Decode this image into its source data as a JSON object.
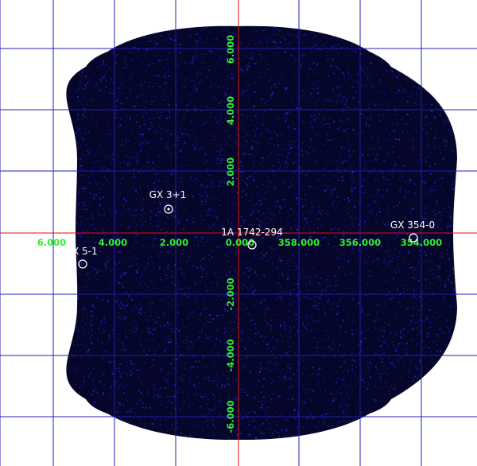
{
  "image": {
    "background_color": "#ffffff",
    "field_color": "#06062a",
    "noise_color": "#1a2fd0",
    "grid_color": "#2222bb",
    "axis_color": "#e01010",
    "tick_label_color": "#33ee33",
    "source_color": "#ffffff"
  },
  "axes": {
    "longitude_ticks": [
      "6.000",
      "4.000",
      "2.000",
      "0.000",
      "358.000",
      "356.000",
      "354.000"
    ],
    "latitude_ticks": [
      "6.000",
      "4.000",
      "2.000",
      "-2.000",
      "-4.000",
      "-6.000"
    ]
  },
  "sources": [
    {
      "id": "gx-3-1",
      "label": "GX 3+1",
      "marker": "circle-with-dot"
    },
    {
      "id": "1a-1742-294",
      "label": "1A 1742-294",
      "marker": "circle"
    },
    {
      "id": "gx-354-0",
      "label": "GX 354-0",
      "marker": "circle"
    },
    {
      "id": "gx-5-1",
      "label": "X 5-1",
      "marker": "circle"
    }
  ]
}
